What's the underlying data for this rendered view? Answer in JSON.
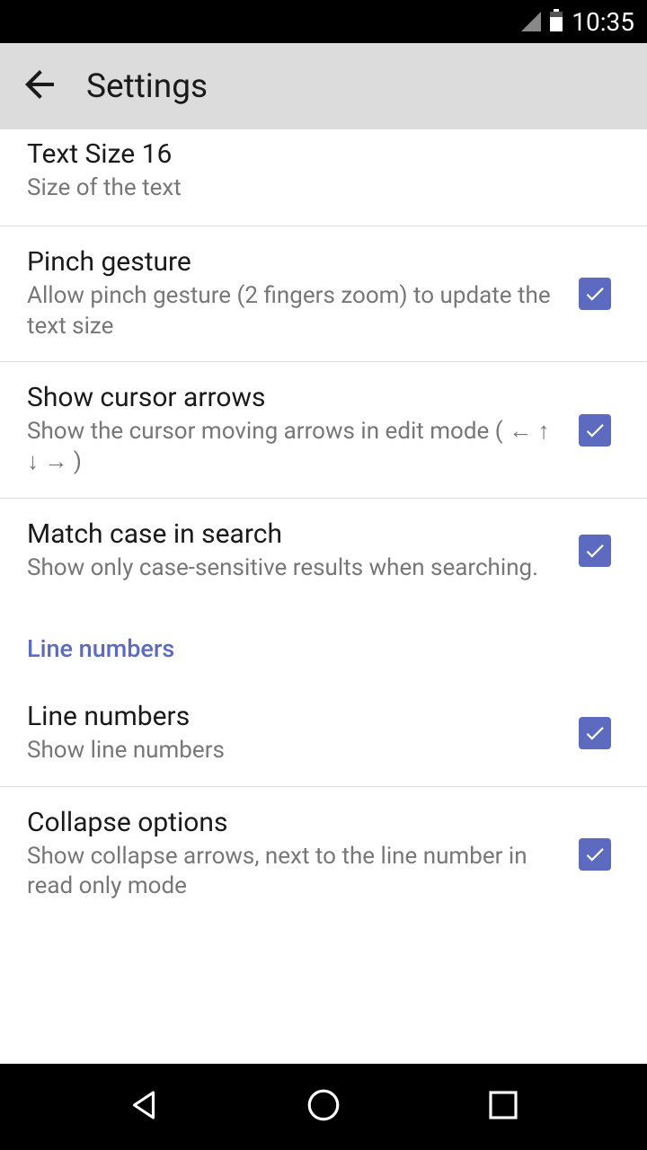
{
  "status_bar": {
    "time": "10:35"
  },
  "header": {
    "title": "Settings"
  },
  "items": {
    "text_size": {
      "title": "Text Size 16",
      "desc": "Size of the text"
    },
    "pinch": {
      "title": "Pinch gesture",
      "desc": "Allow pinch gesture (2 fingers zoom) to update the text size"
    },
    "cursor_arrows": {
      "title": "Show cursor arrows",
      "desc": "Show the cursor moving arrows in edit mode ( ← ↑ ↓ → )"
    },
    "match_case": {
      "title": "Match case in search",
      "desc": "Show only case-sensitive results when searching."
    },
    "line_numbers": {
      "title": "Line numbers",
      "desc": "Show line numbers"
    },
    "collapse": {
      "title": "Collapse options",
      "desc": "Show collapse arrows, next to the line number in read only mode"
    }
  },
  "sections": {
    "line_numbers_header": "Line numbers"
  }
}
